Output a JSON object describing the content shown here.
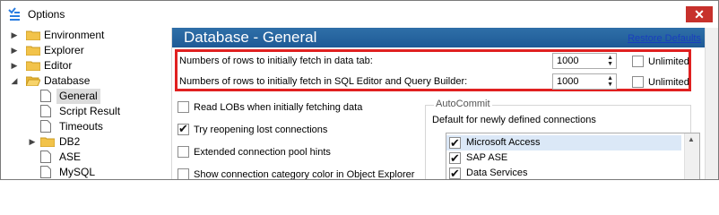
{
  "window": {
    "title": "Options",
    "close_label": "✕"
  },
  "sidebar": {
    "items": [
      {
        "label": "Environment",
        "kind": "folder",
        "expanded": false
      },
      {
        "label": "Explorer",
        "kind": "folder",
        "expanded": false
      },
      {
        "label": "Editor",
        "kind": "folder",
        "expanded": false
      },
      {
        "label": "Database",
        "kind": "folder",
        "expanded": true
      },
      {
        "label": "General",
        "kind": "page",
        "selected": true
      },
      {
        "label": "Script Result",
        "kind": "page"
      },
      {
        "label": "Timeouts",
        "kind": "page"
      },
      {
        "label": "DB2",
        "kind": "folder",
        "expanded": false
      },
      {
        "label": "ASE",
        "kind": "page"
      },
      {
        "label": "MySQL",
        "kind": "page"
      }
    ]
  },
  "header": {
    "title": "Database - General",
    "restore_label": "Restore Defaults"
  },
  "fetch": {
    "rows_data_tab_label": "Numbers of rows to initially fetch in data tab:",
    "rows_data_tab_value": "1000",
    "rows_sql_label": "Numbers of rows to initially fetch in SQL Editor and Query Builder:",
    "rows_sql_value": "1000",
    "unlimited_label": "Unlimited"
  },
  "options": [
    {
      "label": "Read LOBs when initially fetching data",
      "checked": false
    },
    {
      "label": "Try reopening lost connections",
      "checked": true
    },
    {
      "label": "Extended connection pool hints",
      "checked": false
    },
    {
      "label": "Show connection category color in Object Explorer",
      "checked": false
    }
  ],
  "autocommit": {
    "title": "AutoCommit",
    "description": "Default for newly defined connections",
    "items": [
      {
        "label": "Microsoft Access",
        "checked": true,
        "selected": true
      },
      {
        "label": "SAP ASE",
        "checked": true,
        "selected": false
      },
      {
        "label": "Data Services",
        "checked": true,
        "selected": false
      }
    ]
  },
  "colors": {
    "header_bg": "#2f6fa8",
    "highlight": "#e02020",
    "close_bg": "#c7312c"
  }
}
